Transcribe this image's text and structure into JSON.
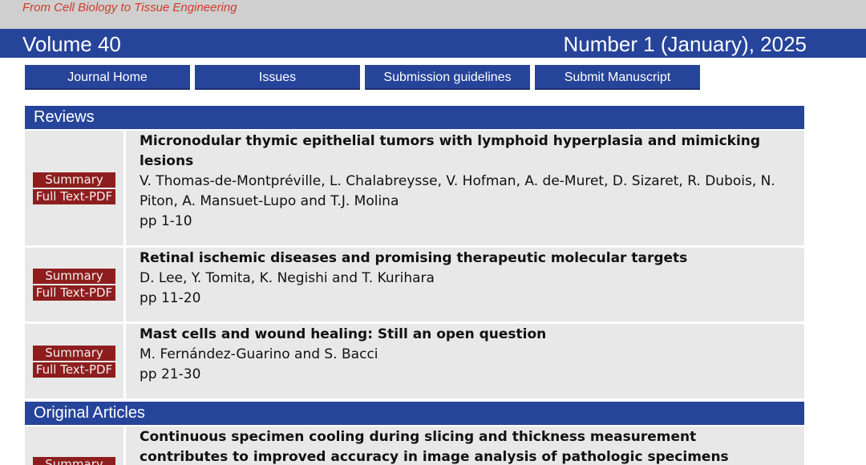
{
  "journal": {
    "tagline": "From Cell Biology to Tissue Engineering",
    "volume": "Volume 40",
    "issue": "Number 1 (January), 2025"
  },
  "nav": {
    "journal_home": "Journal Home",
    "issues": "Issues",
    "submission_guidelines": "Submission guidelines",
    "submit_manuscript": "Submit Manuscript"
  },
  "sections": {
    "reviews": "Reviews",
    "original_articles": "Original Articles"
  },
  "buttons": {
    "summary": "Summary",
    "full_text_pdf": "Full Text-PDF"
  },
  "articles": [
    {
      "title": "Micronodular thymic epithelial tumors with lymphoid hyperplasia and mimicking lesions",
      "authors": "V. Thomas-de-Montpréville, L. Chalabreysse, V. Hofman, A. de-Muret, D. Sizaret, R. Dubois, N. Piton, A. Mansuet-Lupo and T.J. Molina",
      "pages": "pp 1-10"
    },
    {
      "title": "Retinal ischemic diseases and promising therapeutic molecular targets",
      "authors": "D. Lee, Y. Tomita, K. Negishi and T. Kurihara",
      "pages": "pp 11-20"
    },
    {
      "title": "Mast cells and wound healing: Still an open question",
      "authors": "M. Fernández-Guarino and S. Bacci",
      "pages": "pp 21-30"
    },
    {
      "title": "Continuous specimen cooling during slicing and thickness measurement contributes to improved accuracy in image analysis of pathologic specimens",
      "authors": "",
      "pages": ""
    }
  ]
}
